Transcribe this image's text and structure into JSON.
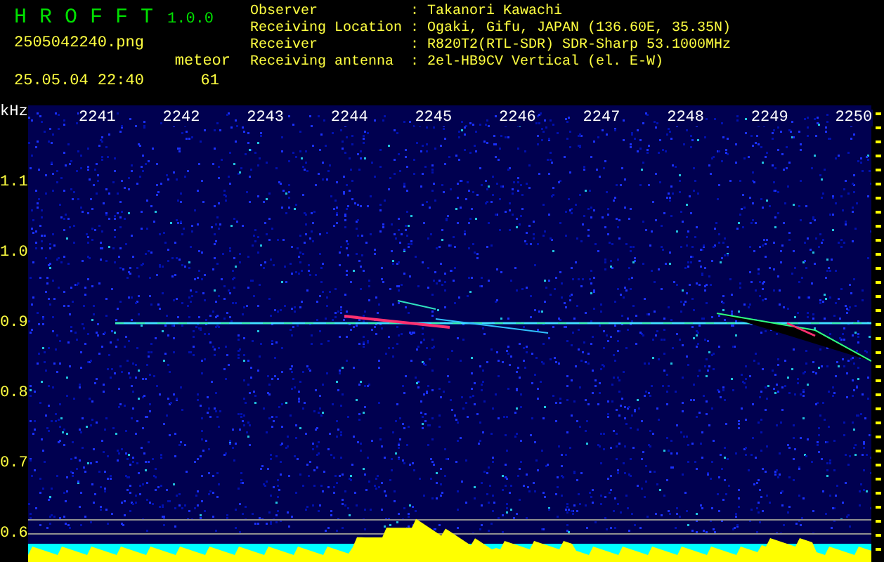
{
  "app": {
    "name": "H R O F F T",
    "version": "1.0.0",
    "filename": "2505042240.png",
    "timestamp": "25.05.04 22:40",
    "count_label": "meteor",
    "count": "61"
  },
  "station": [
    {
      "label": "Observer",
      "value": ": Takanori Kawachi"
    },
    {
      "label": "Receiving Location",
      "value": ": Ogaki, Gifu, JAPAN (136.60E, 35.35N)"
    },
    {
      "label": "Receiver",
      "value": ": R820T2(RTL-SDR) SDR-Sharp 53.1000MHz"
    },
    {
      "label": "Receiving antenna",
      "value": ": 2el-HB9CV Vertical (el. E-W)"
    }
  ],
  "spectrogram": {
    "y_unit": "kHz",
    "x_ticks": [
      "2241",
      "2242",
      "2243",
      "2244",
      "2245",
      "2246",
      "2247",
      "2248",
      "2249",
      "2250"
    ],
    "y_ticks": [
      "1.1",
      "1.0",
      "0.9",
      "0.8",
      "0.7",
      "0.6"
    ]
  }
}
